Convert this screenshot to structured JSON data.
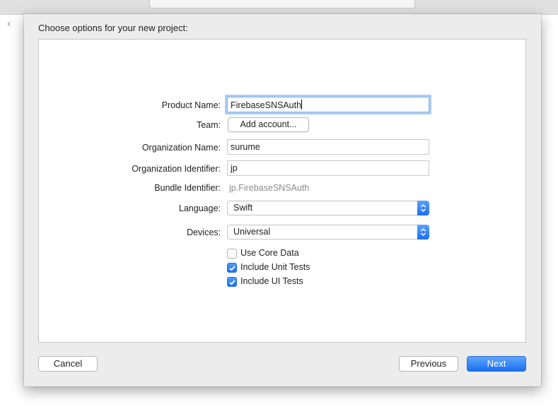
{
  "sheet": {
    "title": "Choose options for your new project:"
  },
  "form": {
    "product_name": {
      "label": "Product Name:",
      "value": "FirebaseSNSAuth"
    },
    "team": {
      "label": "Team:",
      "button": "Add account..."
    },
    "organization_name": {
      "label": "Organization Name:",
      "value": "surume"
    },
    "organization_identifier": {
      "label": "Organization Identifier:",
      "value": "jp"
    },
    "bundle_identifier": {
      "label": "Bundle Identifier:",
      "value": "jp.FirebaseSNSAuth"
    },
    "language": {
      "label": "Language:",
      "value": "Swift"
    },
    "devices": {
      "label": "Devices:",
      "value": "Universal"
    },
    "checkboxes": [
      {
        "label": "Use Core Data",
        "checked": false
      },
      {
        "label": "Include Unit Tests",
        "checked": true
      },
      {
        "label": "Include UI Tests",
        "checked": true
      }
    ]
  },
  "buttons": {
    "cancel": "Cancel",
    "previous": "Previous",
    "next": "Next"
  },
  "colors": {
    "accent": "#1a6ff0",
    "focus_ring": "#a9cdf7"
  },
  "icons": {
    "back": "chevron-left-icon",
    "popup": "up-down-arrows-icon",
    "check": "checkmark-icon"
  }
}
